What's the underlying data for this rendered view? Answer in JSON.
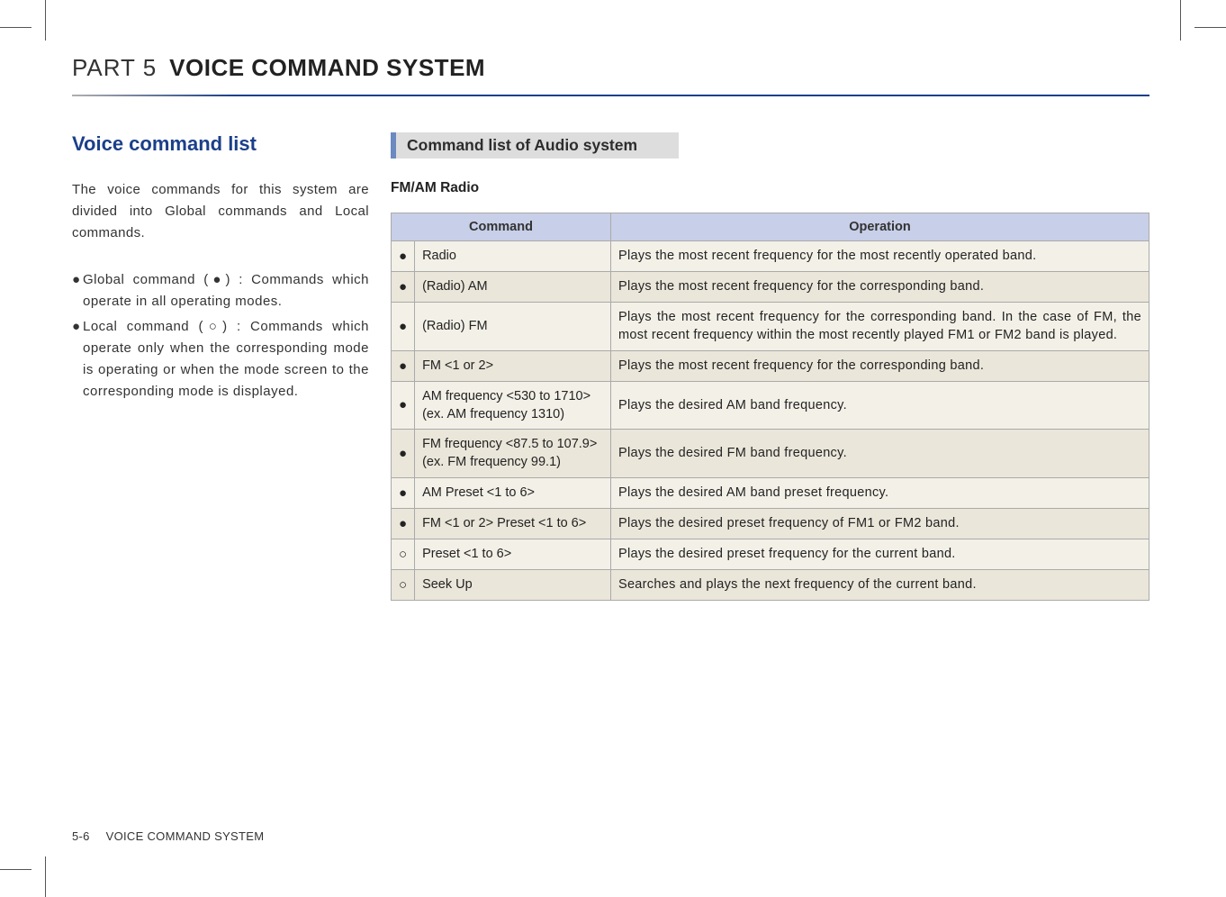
{
  "header": {
    "part_label": "PART 5",
    "part_title": "VOICE COMMAND SYSTEM"
  },
  "section_title": "Voice command list",
  "intro_para": "The voice commands for this system are divided into Global commands and Local commands.",
  "bullets": [
    "Global command (●) : Commands which operate in all operating modes.",
    "Local command (○) : Commands which operate only when the corresponding mode is operating or when the mode screen to the corresponding mode is displayed."
  ],
  "audio_header": "Command list of Audio system",
  "table_label": "FM/AM Radio",
  "table_headers": {
    "command": "Command",
    "operation": "Operation"
  },
  "rows": [
    {
      "type": "●",
      "cmd": "Radio",
      "op": "Plays the most recent frequency for the most recently operated band."
    },
    {
      "type": "●",
      "cmd": "(Radio) AM",
      "op": "Plays the most recent frequency for the corresponding band."
    },
    {
      "type": "●",
      "cmd": " (Radio) FM",
      "op": "Plays the most recent frequency for the corresponding band. In the case of FM, the most recent frequency within the most recently played FM1 or FM2 band is played."
    },
    {
      "type": "●",
      "cmd": "FM <1 or 2>",
      "op": "Plays the most recent frequency for the corresponding band."
    },
    {
      "type": "●",
      "cmd": "AM frequency <530 to 1710> (ex. AM frequency 1310)",
      "op": "Plays the desired AM band frequency."
    },
    {
      "type": "●",
      "cmd": "FM frequency <87.5 to 107.9> (ex. FM frequency 99.1)",
      "op": "Plays the desired FM band frequency."
    },
    {
      "type": "●",
      "cmd": "AM Preset <1 to 6>",
      "op": "Plays the desired AM band preset frequency."
    },
    {
      "type": "●",
      "cmd": "FM <1 or 2> Preset <1 to 6>",
      "op": "Plays the desired preset frequency of FM1 or FM2 band."
    },
    {
      "type": "○",
      "cmd": "Preset <1 to 6>",
      "op": "Plays the desired preset frequency for the current band."
    },
    {
      "type": "○",
      "cmd": "Seek Up",
      "op": "Searches and plays the next frequency of the current band."
    }
  ],
  "footer": {
    "page_num": "5-6",
    "section": "VOICE COMMAND SYSTEM"
  }
}
